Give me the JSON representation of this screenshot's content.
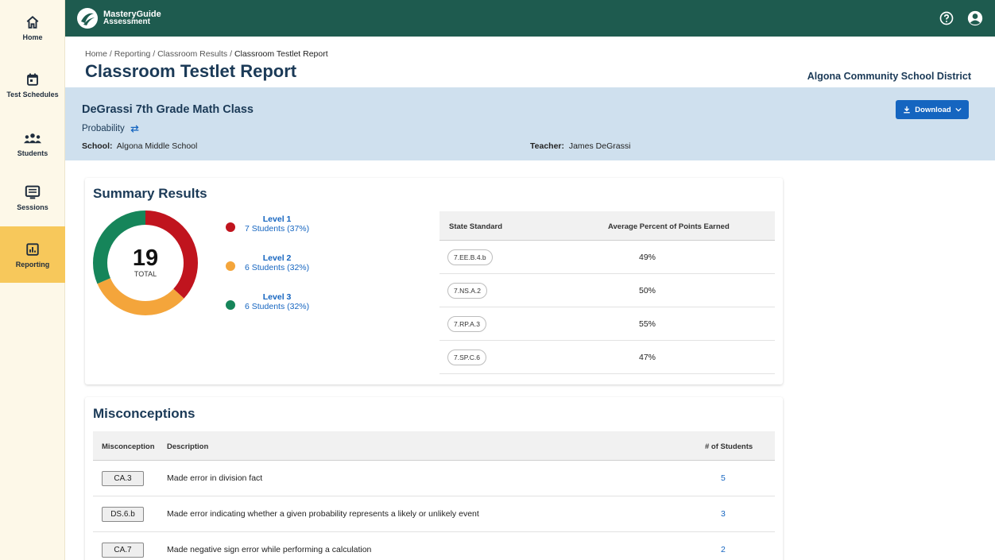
{
  "sidebar": {
    "items": [
      {
        "label": "Home",
        "icon": "home-icon"
      },
      {
        "label": "Test Schedules",
        "icon": "calendar-icon"
      },
      {
        "label": "Students",
        "icon": "students-icon"
      },
      {
        "label": "Sessions",
        "icon": "sessions-icon"
      },
      {
        "label": "Reporting",
        "icon": "reporting-icon",
        "active": true
      }
    ]
  },
  "header": {
    "logo_line1": "MasteryGuide",
    "logo_line2": "Assessment",
    "icons": [
      "help-icon",
      "account-icon"
    ]
  },
  "breadcrumb": {
    "home": "Home",
    "reporting": "Reporting",
    "classroom_results": "Classroom Results",
    "current": "Classroom Testlet Report",
    "separator": " / "
  },
  "page_title": "Classroom Testlet Report",
  "district": "Algona Community School District",
  "class_info": {
    "name": "DeGrassi 7th Grade Math Class",
    "subject": "Probability",
    "school_label": "School:",
    "school": "Algona Middle School",
    "teacher_label": "Teacher:",
    "teacher": "James DeGrassi",
    "download_label": "Download"
  },
  "summary": {
    "title": "Summary Results",
    "total": "19",
    "total_label": "TOTAL",
    "levels": [
      {
        "label": "Level 1",
        "students": "7 Students (37%)",
        "count": 7,
        "color": "#c0141e"
      },
      {
        "label": "Level 2",
        "students": "6 Students (32%)",
        "count": 6,
        "color": "#f4a53b"
      },
      {
        "label": "Level 3",
        "students": "6 Students (32%)",
        "count": 6,
        "color": "#16855a"
      }
    ],
    "table": {
      "col1": "State Standard",
      "col2": "Average Percent of Points Earned",
      "rows": [
        {
          "standard": "7.EE.B.4.b",
          "percent": "49%"
        },
        {
          "standard": "7.NS.A.2",
          "percent": "50%"
        },
        {
          "standard": "7.RP.A.3",
          "percent": "55%"
        },
        {
          "standard": "7.SP.C.6",
          "percent": "47%"
        }
      ]
    }
  },
  "misconceptions": {
    "title": "Misconceptions",
    "col1": "Misconception",
    "col2": "Description",
    "col3": "# of Students",
    "rows": [
      {
        "code": "CA.3",
        "description": "Made error in division fact",
        "students": "5"
      },
      {
        "code": "DS.6.b",
        "description": "Made error indicating whether a given probability represents a likely or unlikely event",
        "students": "3"
      },
      {
        "code": "CA.7",
        "description": "Made negative sign error while performing a calculation",
        "students": "2"
      }
    ]
  }
}
